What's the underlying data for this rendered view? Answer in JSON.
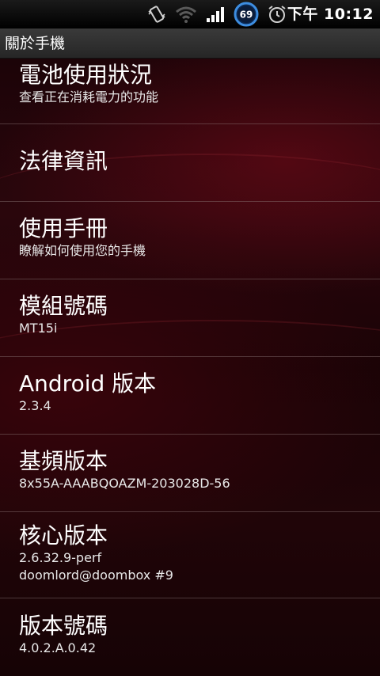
{
  "status_bar": {
    "icons": [
      "vibrate-icon",
      "wifi-icon",
      "signal-icon",
      "battery-icon",
      "alarm-icon"
    ],
    "battery_level": "69",
    "time": "下午 10:12"
  },
  "title_bar": {
    "title": "關於手機"
  },
  "items": [
    {
      "title": "電池使用狀況",
      "summary": "查看正在消耗電力的功能"
    },
    {
      "title": "法律資訊",
      "summary": ""
    },
    {
      "title": "使用手冊",
      "summary": "瞭解如何使用您的手機"
    },
    {
      "title": "模組號碼",
      "summary": "MT15i"
    },
    {
      "title": "Android 版本",
      "summary": "2.3.4"
    },
    {
      "title": "基頻版本",
      "summary": "8x55A-AAABQOAZM-203028D-56"
    },
    {
      "title": "核心版本",
      "summary": "2.6.32.9-perf",
      "summary2": "doomlord@doombox #9"
    },
    {
      "title": "版本號碼",
      "summary": "4.0.2.A.0.42"
    }
  ],
  "colors": {
    "background": "#1c0408",
    "accent": "#2f7fd6",
    "text": "#ffffff"
  }
}
